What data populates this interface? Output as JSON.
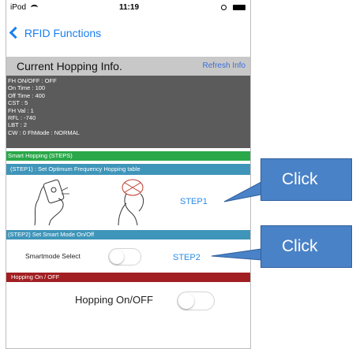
{
  "status_bar": {
    "carrier": "iPod",
    "time": "11:19"
  },
  "nav": {
    "back_label": "RFID Functions"
  },
  "hopping_info": {
    "title": "Current Hopping Info.",
    "refresh_label": "Refresh Info",
    "lines": [
      "FH ON/OFF : OFF",
      "On Time : 100",
      "Off Time : 400",
      "CST : 5",
      "FH Val : 1",
      "RFL : -740",
      "LBT : 2",
      "CW : 0  FhMode : NORMAL"
    ]
  },
  "smart_hopping": {
    "title": "Smart Hopping (STEPS)",
    "step1_title": "(STEP1) : Set Optimum Frequency Hopping table",
    "step1_button": "STEP1",
    "step2_title": "(STEP2) Set Smart Mode On/Off",
    "smartmode_label": "Smartmode Select",
    "smartmode_on": false,
    "step2_button": "STEP2"
  },
  "hopping_onoff": {
    "section_title": "Hopping On / OFF",
    "label": "Hopping On/OFF",
    "on": false
  },
  "callouts": [
    {
      "text": "Click"
    },
    {
      "text": "Click"
    }
  ],
  "colors": {
    "accent_blue": "#1a7ff0",
    "info_panel": "#5b5b5b",
    "smart_green": "#2aa84a",
    "step_bar_blue": "#3f95b9",
    "hopping_red": "#a11f22",
    "callout_blue": "#4a82c7"
  },
  "icons": [
    "wifi-icon",
    "battery-icon",
    "back-chevron-icon",
    "hand-reader-icon",
    "hand-tag-icon"
  ]
}
